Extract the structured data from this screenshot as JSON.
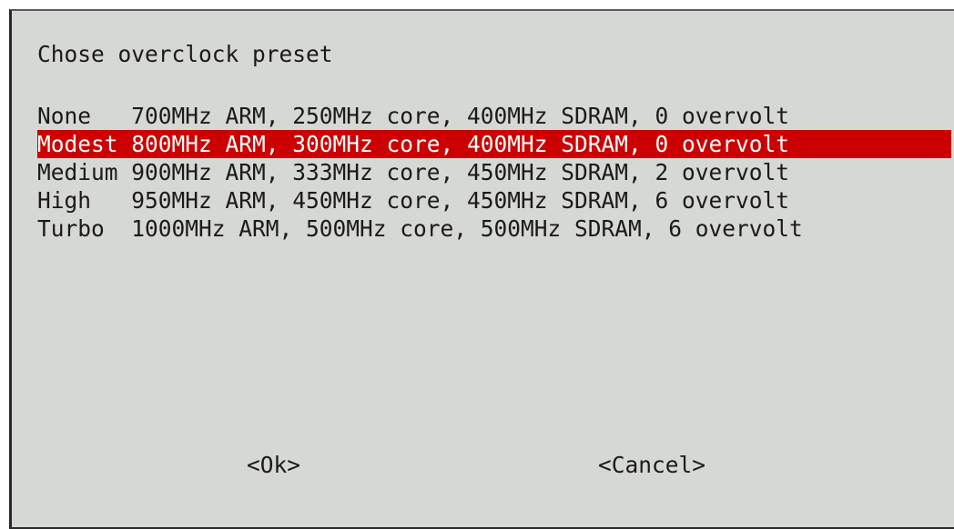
{
  "dialog": {
    "title": "Chose overclock preset",
    "options": [
      {
        "name": "None  ",
        "desc": " 700MHz ARM, 250MHz core, 400MHz SDRAM, 0 overvolt",
        "selected": false
      },
      {
        "name": "Modest",
        "desc": " 800MHz ARM, 300MHz core, 400MHz SDRAM, 0 overvolt",
        "selected": true
      },
      {
        "name": "Medium",
        "desc": " 900MHz ARM, 333MHz core, 450MHz SDRAM, 2 overvolt",
        "selected": false
      },
      {
        "name": "High  ",
        "desc": " 950MHz ARM, 450MHz core, 450MHz SDRAM, 6 overvolt",
        "selected": false
      },
      {
        "name": "Turbo ",
        "desc": " 1000MHz ARM, 500MHz core, 500MHz SDRAM, 6 overvolt",
        "selected": false
      }
    ],
    "ok_label": "<Ok>",
    "cancel_label": "<Cancel>"
  },
  "colors": {
    "background": "#d6d8d3",
    "highlight": "#cc0000",
    "text": "#1a1a1a",
    "highlight_text": "#ffffff"
  }
}
